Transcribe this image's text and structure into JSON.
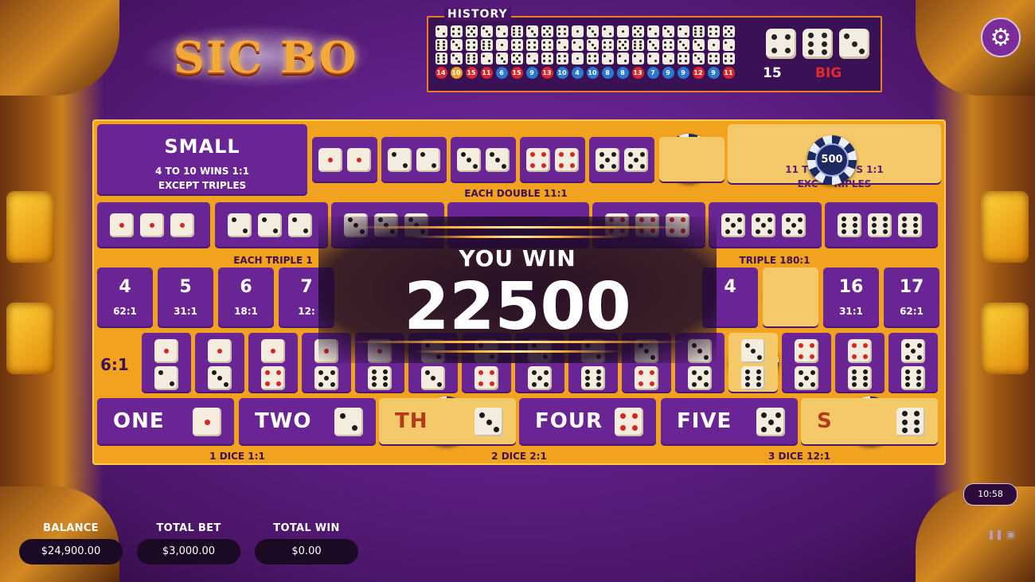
{
  "logo": {
    "text": "SIC BO"
  },
  "history": {
    "title": "HISTORY",
    "columns": [
      {
        "dice": [
          2,
          6,
          6
        ],
        "sum": "14",
        "color": "#d8262a"
      },
      {
        "dice": [
          4,
          3,
          3
        ],
        "sum": "10",
        "color": "#f0a020"
      },
      {
        "dice": [
          5,
          4,
          6
        ],
        "sum": "15",
        "color": "#d8262a"
      },
      {
        "dice": [
          3,
          6,
          2
        ],
        "sum": "11",
        "color": "#d8262a"
      },
      {
        "dice": [
          2,
          1,
          3
        ],
        "sum": "6",
        "color": "#2a78d0"
      },
      {
        "dice": [
          6,
          4,
          5
        ],
        "sum": "15",
        "color": "#d8262a"
      },
      {
        "dice": [
          3,
          4,
          2
        ],
        "sum": "9",
        "color": "#2a78d0"
      },
      {
        "dice": [
          5,
          4,
          4
        ],
        "sum": "13",
        "color": "#d8262a"
      },
      {
        "dice": [
          4,
          2,
          4
        ],
        "sum": "10",
        "color": "#2a78d0"
      },
      {
        "dice": [
          1,
          2,
          1
        ],
        "sum": "4",
        "color": "#2a78d0"
      },
      {
        "dice": [
          3,
          3,
          4
        ],
        "sum": "10",
        "color": "#2a78d0"
      },
      {
        "dice": [
          2,
          4,
          2
        ],
        "sum": "8",
        "color": "#2a78d0"
      },
      {
        "dice": [
          1,
          5,
          2
        ],
        "sum": "8",
        "color": "#2a78d0"
      },
      {
        "dice": [
          5,
          6,
          2
        ],
        "sum": "13",
        "color": "#d8262a"
      },
      {
        "dice": [
          2,
          3,
          2
        ],
        "sum": "7",
        "color": "#2a78d0"
      },
      {
        "dice": [
          3,
          4,
          2
        ],
        "sum": "9",
        "color": "#2a78d0"
      },
      {
        "dice": [
          2,
          3,
          4
        ],
        "sum": "9",
        "color": "#2a78d0"
      },
      {
        "dice": [
          6,
          3,
          3
        ],
        "sum": "12",
        "color": "#d8262a"
      },
      {
        "dice": [
          4,
          1,
          4
        ],
        "sum": "9",
        "color": "#2a78d0"
      },
      {
        "dice": [
          5,
          2,
          4
        ],
        "sum": "11",
        "color": "#d8262a"
      }
    ],
    "last": {
      "dice": [
        4,
        6,
        3
      ],
      "sum": "15",
      "result": "BIG"
    }
  },
  "board": {
    "small": {
      "title": "SMALL",
      "line1": "4 TO 10 WINS 1:1",
      "line2": "EXCEPT TRIPLES"
    },
    "big": {
      "line1": "11 T",
      "line1b": "S 1:1",
      "line2": "EXC",
      "line2b": "RIPLES"
    },
    "each_double": "EACH DOUBLE 11:1",
    "each_triple": "EACH TRIPLE 180:1",
    "any_triple_left": "EACH TRIPLE 1",
    "any_triple_right": "TRIPLE 180:1",
    "totals": [
      {
        "n": "4",
        "p": "62:1"
      },
      {
        "n": "5",
        "p": "31:1"
      },
      {
        "n": "6",
        "p": "18:1"
      },
      {
        "n": "7",
        "p": "12:"
      },
      {
        "n": "4",
        "p": ""
      },
      {
        "n": "16",
        "p": "31:1"
      },
      {
        "n": "17",
        "p": "62:1"
      }
    ],
    "combo_label": "6:1",
    "singles": [
      {
        "label": "ONE"
      },
      {
        "label": "TWO"
      },
      {
        "label": "TH"
      },
      {
        "label": "FOUR"
      },
      {
        "label": "FIVE"
      },
      {
        "label": "S"
      }
    ],
    "one_dice": "1 DICE 1:1",
    "two_dice": "2 DICE 2:1",
    "three_dice": "3 DICE 12:1",
    "chip_value": "500"
  },
  "win": {
    "caption": "YOU WIN",
    "amount": "22500"
  },
  "footer": {
    "balance_label": "BALANCE",
    "balance": "$24,900.00",
    "totalbet_label": "TOTAL BET",
    "totalbet": "$3,000.00",
    "totalwin_label": "TOTAL WIN",
    "totalwin": "$0.00",
    "clock": "10:58"
  },
  "icons": {
    "settings": "gear-icon"
  }
}
